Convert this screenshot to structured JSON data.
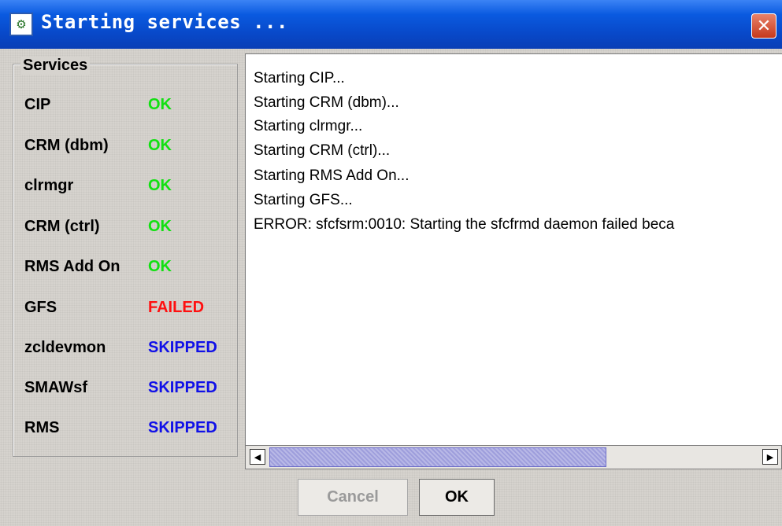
{
  "window": {
    "title": "Starting services ...",
    "icon": "cluster-app-icon",
    "close_symbol": "✕"
  },
  "services": {
    "legend": "Services",
    "items": [
      {
        "name": "CIP",
        "status": "OK"
      },
      {
        "name": "CRM (dbm)",
        "status": "OK"
      },
      {
        "name": "clrmgr",
        "status": "OK"
      },
      {
        "name": "CRM (ctrl)",
        "status": "OK"
      },
      {
        "name": "RMS Add On",
        "status": "OK"
      },
      {
        "name": "GFS",
        "status": "FAILED"
      },
      {
        "name": "zcldevmon",
        "status": "SKIPPED"
      },
      {
        "name": "SMAWsf",
        "status": "SKIPPED"
      },
      {
        "name": "RMS",
        "status": "SKIPPED"
      }
    ],
    "status_colors": {
      "OK": "#11e011",
      "FAILED": "#ff1010",
      "SKIPPED": "#1010e8"
    }
  },
  "log": {
    "lines": [
      "Starting CIP...",
      "Starting CRM (dbm)...",
      "Starting clrmgr...",
      "Starting CRM (ctrl)...",
      "Starting RMS Add On...",
      "Starting GFS...",
      "ERROR: sfcfsrm:0010: Starting the sfcfrmd daemon failed beca"
    ]
  },
  "scrollbar": {
    "left_arrow": "◀",
    "right_arrow": "▶"
  },
  "buttons": {
    "cancel_label": "Cancel",
    "ok_label": "OK"
  }
}
